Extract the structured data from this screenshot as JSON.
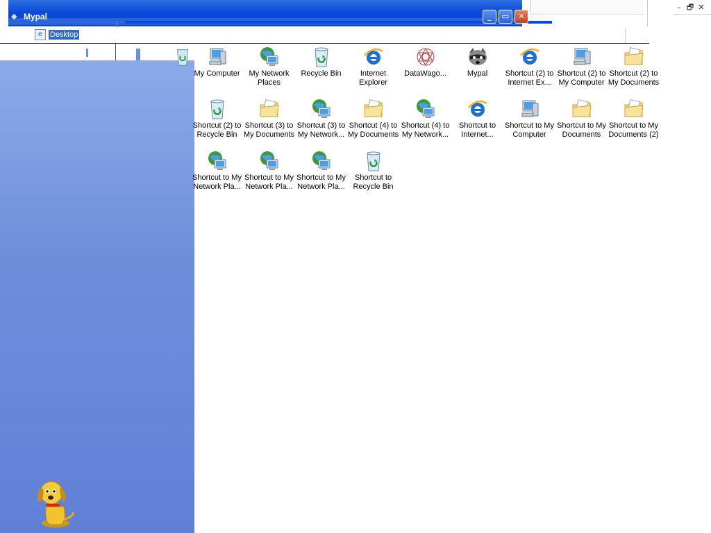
{
  "window": {
    "title": "Mypal",
    "buttons": {
      "minimize": "_",
      "restore": "▭",
      "close": "✕"
    }
  },
  "mdi_controls": {
    "minimize": "–",
    "restore": "🗗",
    "close": "✕"
  },
  "tree": {
    "selected_label": "Desktop"
  },
  "icons": [
    {
      "label": "My Computer",
      "type": "computer"
    },
    {
      "label": "My Network\nPlaces",
      "type": "network"
    },
    {
      "label": "Recycle Bin",
      "type": "recycle"
    },
    {
      "label": "Internet\nExplorer",
      "type": "ie"
    },
    {
      "label": "DataWago...",
      "type": "datawago"
    },
    {
      "label": "Mypal",
      "type": "mypal"
    },
    {
      "label": "Shortcut (2) to\nInternet Ex...",
      "type": "ie"
    },
    {
      "label": "Shortcut (2) to\nMy Computer",
      "type": "computer"
    },
    {
      "label": "Shortcut (2) to\nMy Documents",
      "type": "folder"
    },
    {
      "label": "Shortcut (2) to\nRecycle Bin",
      "type": "recycle"
    },
    {
      "label": "Shortcut (3) to\nMy Documents",
      "type": "folder"
    },
    {
      "label": "Shortcut (3) to\nMy Network...",
      "type": "network"
    },
    {
      "label": "Shortcut (4) to\nMy Documents",
      "type": "folder"
    },
    {
      "label": "Shortcut (4) to\nMy Network...",
      "type": "network"
    },
    {
      "label": "Shortcut to\nInternet...",
      "type": "ie"
    },
    {
      "label": "Shortcut to My\nComputer",
      "type": "computer"
    },
    {
      "label": "Shortcut to My\nDocuments",
      "type": "folder"
    },
    {
      "label": "Shortcut to My\nDocuments (2)",
      "type": "folder"
    },
    {
      "label": "Shortcut to My\nNetwork Pla...",
      "type": "network"
    },
    {
      "label": "Shortcut to My\nNetwork Pla...",
      "type": "network"
    },
    {
      "label": "Shortcut to My\nNetwork Pla...",
      "type": "network"
    },
    {
      "label": "Shortcut to\nRecycle Bin",
      "type": "recycle"
    }
  ]
}
